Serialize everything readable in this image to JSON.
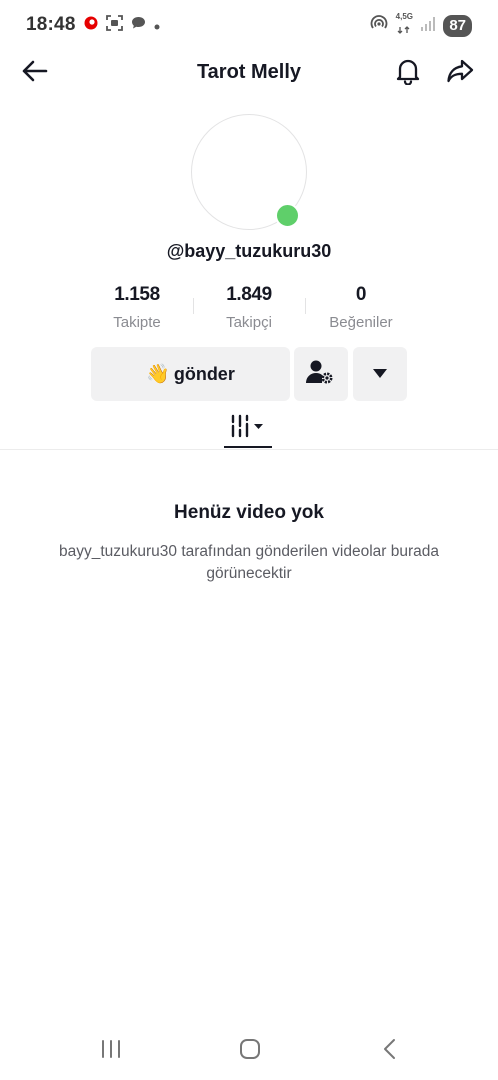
{
  "status_bar": {
    "time": "18:48",
    "network": "4,5G",
    "battery": "87"
  },
  "header": {
    "title": "Tarot Melly",
    "back_icon": "arrow-left-icon",
    "bell_icon": "bell-icon",
    "share_icon": "share-arrow-icon"
  },
  "profile": {
    "username": "@bayy_tuzukuru30",
    "online_color": "#5fcf6a"
  },
  "stats": [
    {
      "value": "1.158",
      "label": "Takipte"
    },
    {
      "value": "1.849",
      "label": "Takipçi"
    },
    {
      "value": "0",
      "label": "Beğeniler"
    }
  ],
  "actions": {
    "send_emoji": "👋",
    "send_label": "gönder",
    "friend_icon": "person-settings-icon",
    "more_icon": "caret-down-icon"
  },
  "tabs": {
    "active_icon": "filter-sort-icon"
  },
  "empty_state": {
    "title": "Henüz video yok",
    "description": "bayy_tuzukuru30 tarafından gönderilen videolar burada görünecektir"
  },
  "nav": {
    "recents_icon": "recents-icon",
    "home_icon": "home-icon",
    "back_icon": "back-chevron-icon"
  }
}
